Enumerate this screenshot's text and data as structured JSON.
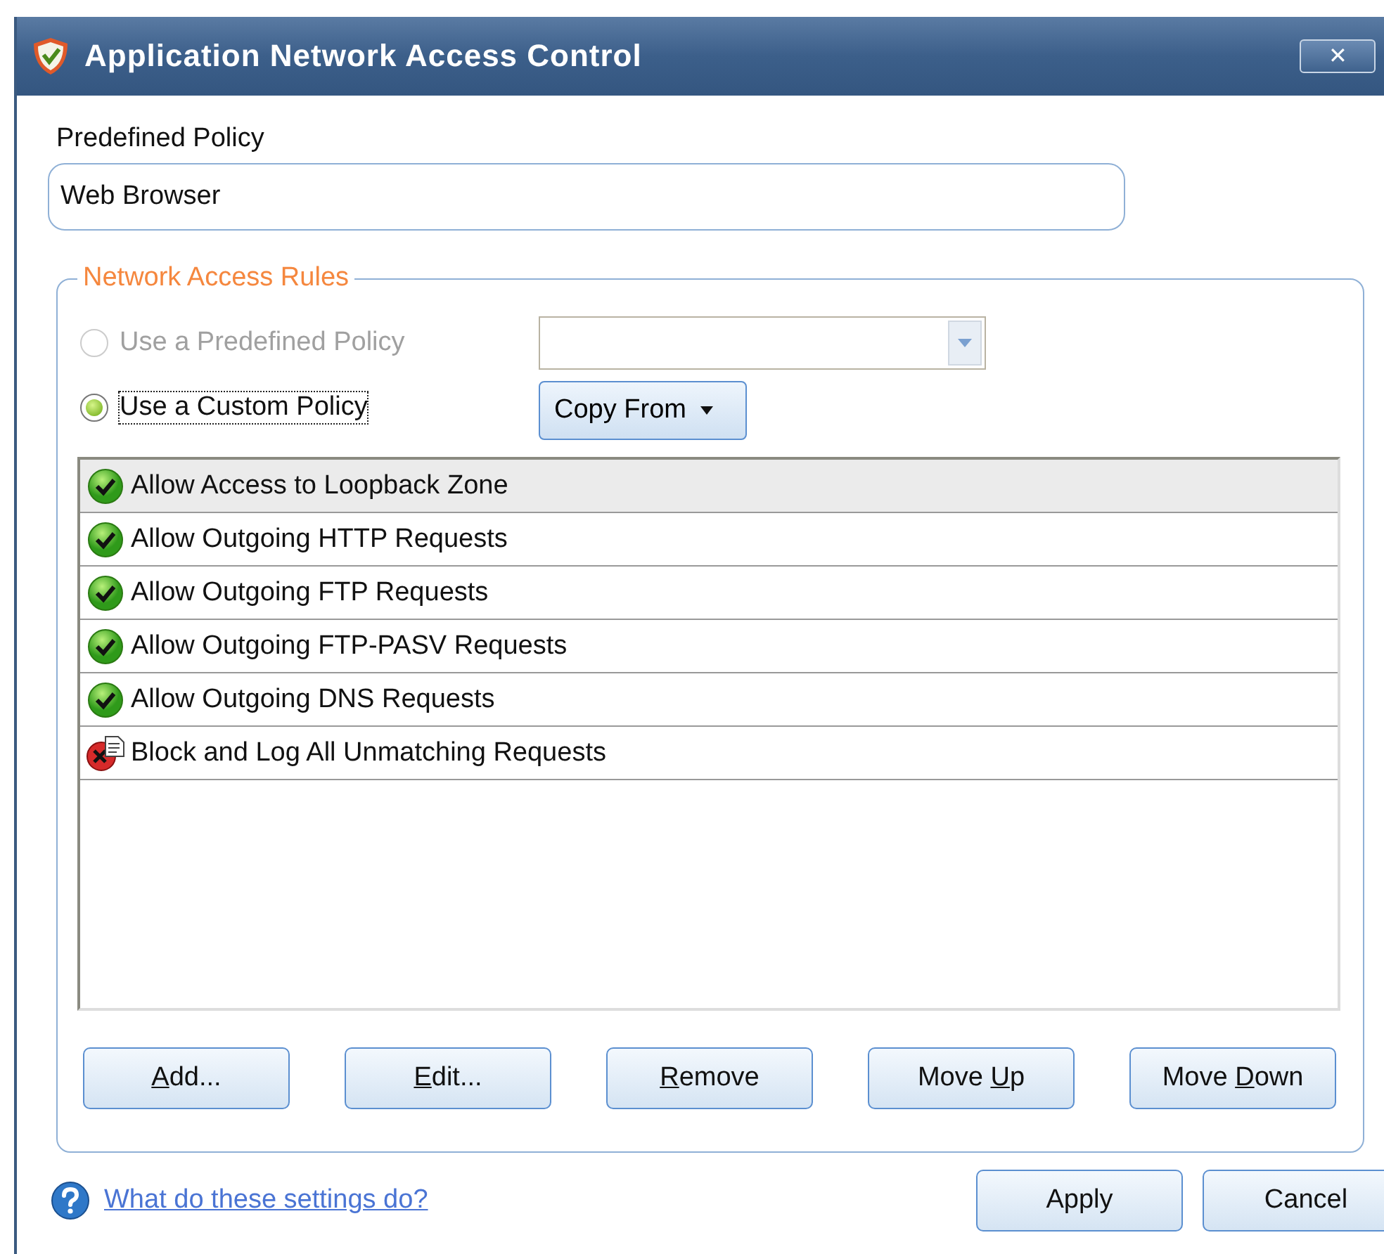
{
  "window": {
    "title": "Application Network Access Control",
    "close_label": "✕"
  },
  "predefined_policy": {
    "label": "Predefined Policy",
    "value": "Web Browser"
  },
  "rules_group": {
    "legend": "Network Access Rules",
    "options": [
      {
        "label": "Use a Predefined Policy",
        "selected": false,
        "disabled": true,
        "focused": false
      },
      {
        "label": "Use a Custom Policy",
        "selected": true,
        "disabled": false,
        "focused": true
      }
    ],
    "policy_combo": {
      "disabled": true
    },
    "copy_from": {
      "label": "Copy From"
    },
    "rules": [
      {
        "label": "Allow Access to Loopback Zone",
        "kind": "allow",
        "selected": true
      },
      {
        "label": "Allow Outgoing HTTP Requests",
        "kind": "allow",
        "selected": false
      },
      {
        "label": "Allow Outgoing FTP Requests",
        "kind": "allow",
        "selected": false
      },
      {
        "label": "Allow Outgoing FTP-PASV Requests",
        "kind": "allow",
        "selected": false
      },
      {
        "label": "Allow Outgoing DNS Requests",
        "kind": "allow",
        "selected": false
      },
      {
        "label": "Block and Log All Unmatching Requests",
        "kind": "block_log",
        "selected": false
      }
    ],
    "buttons": [
      {
        "key": "A",
        "after": "dd..."
      },
      {
        "key": "E",
        "after": "dit..."
      },
      {
        "key": "R",
        "after": "emove"
      },
      {
        "before": "Move ",
        "key": "U",
        "after": "p"
      },
      {
        "before": "Move ",
        "key": "D",
        "after": "own"
      }
    ]
  },
  "help_link": "What do these settings do?",
  "footer_buttons": [
    "Apply",
    "Cancel"
  ]
}
